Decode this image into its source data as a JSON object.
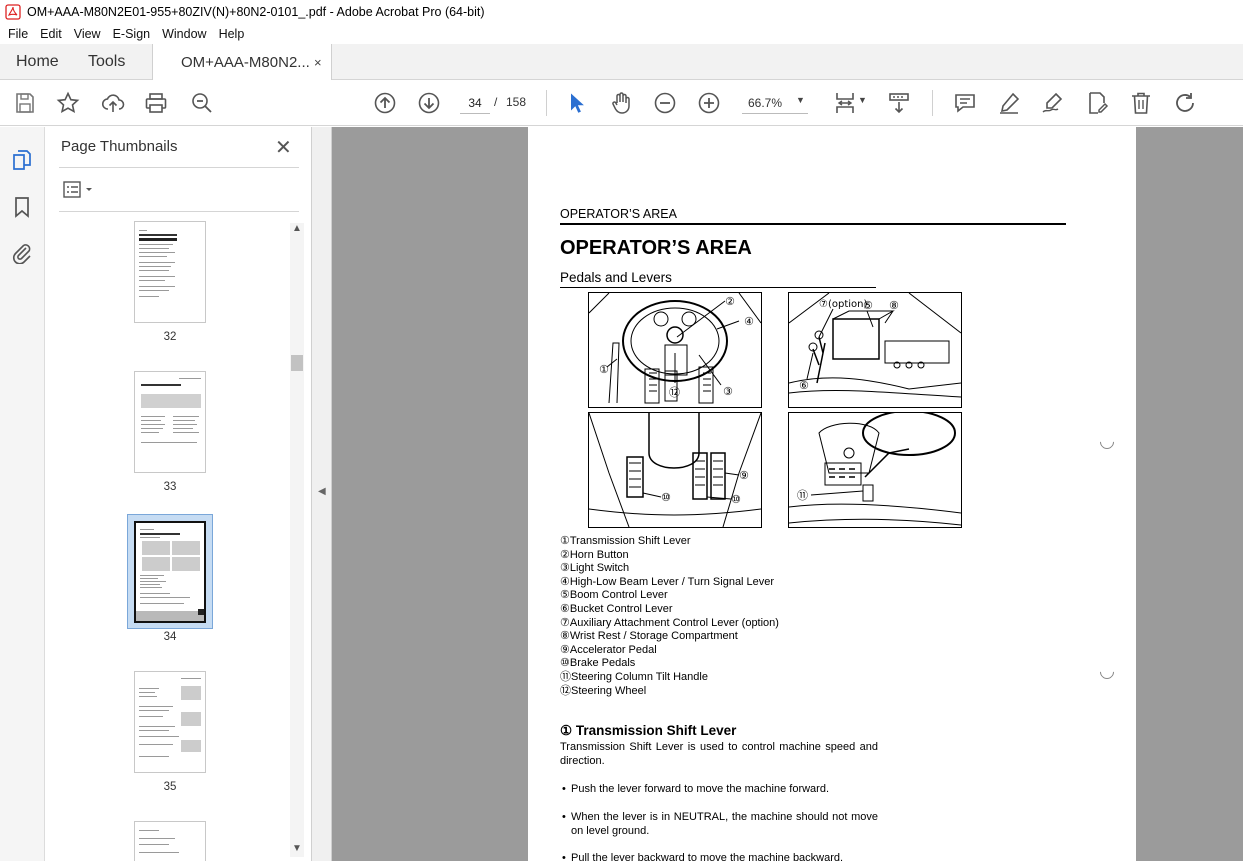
{
  "window": {
    "title": "OM+AAA-M80N2E01-955+80ZIV(N)+80N2-0101_.pdf - Adobe Acrobat Pro (64-bit)"
  },
  "menu": [
    "File",
    "Edit",
    "View",
    "E-Sign",
    "Window",
    "Help"
  ],
  "tabs": {
    "home": "Home",
    "tools": "Tools",
    "document": "OM+AAA-M80N2...",
    "close_glyph": "×"
  },
  "toolbar": {
    "page_current": "34",
    "page_separator": "/",
    "page_total": "158",
    "zoom": "66.7%"
  },
  "panel": {
    "title": "Page Thumbnails",
    "close_glyph": "✕",
    "thumbnails": [
      {
        "label": "32"
      },
      {
        "label": "33"
      },
      {
        "label": "34",
        "selected": true
      },
      {
        "label": "35"
      }
    ]
  },
  "document": {
    "header": "OPERATOR’S AREA",
    "title": "OPERATOR’S AREA",
    "subtitle": "Pedals and Levers",
    "figure_callouts": {
      "fig1": [
        "②",
        "④",
        "①",
        "⑫",
        "③"
      ],
      "fig2": [
        "⑦(option)",
        "⑤",
        "⑧",
        "⑥"
      ],
      "fig3": [
        "⑨",
        "⑩",
        "⑩"
      ],
      "fig4": [
        "⑪"
      ]
    },
    "legend": [
      "①Transmission Shift Lever",
      "②Horn Button",
      "③Light Switch",
      "④High-Low Beam Lever / Turn Signal Lever",
      "⑤Boom Control Lever",
      "⑥Bucket Control Lever",
      "⑦Auxiliary Attachment Control Lever (option)",
      "⑧Wrist Rest / Storage Compartment",
      "⑨Accelerator Pedal",
      "⑩Brake Pedals",
      "⑪Steering Column Tilt Handle",
      "⑫Steering Wheel"
    ],
    "section_heading": "① Transmission Shift Lever",
    "section_intro": "Transmission Shift Lever is used to control machine speed and direction.",
    "bullets": [
      "Push the lever forward to move the machine forward.",
      "When the lever is in NEUTRAL, the machine should not move on level ground.",
      "Pull the lever backward to move the machine backward."
    ]
  },
  "colors": {
    "accent_blue": "#2b6fd1",
    "toolbar_icon": "#555555",
    "viewer_bg": "#9b9b9b"
  },
  "icons": {
    "toolbar": [
      "save-icon",
      "star-icon",
      "upload-icon",
      "print-icon",
      "zoom-search-icon",
      "page-up-icon",
      "page-down-icon",
      "select-arrow-icon",
      "hand-icon",
      "zoom-out-icon",
      "zoom-in-icon",
      "page-fit-icon",
      "scroll-mode-icon",
      "comment-icon",
      "highlight-icon",
      "sign-icon",
      "edit-pdf-icon",
      "delete-icon",
      "rotate-icon"
    ],
    "rail": [
      "pages-icon",
      "bookmark-icon",
      "attachment-icon"
    ]
  }
}
